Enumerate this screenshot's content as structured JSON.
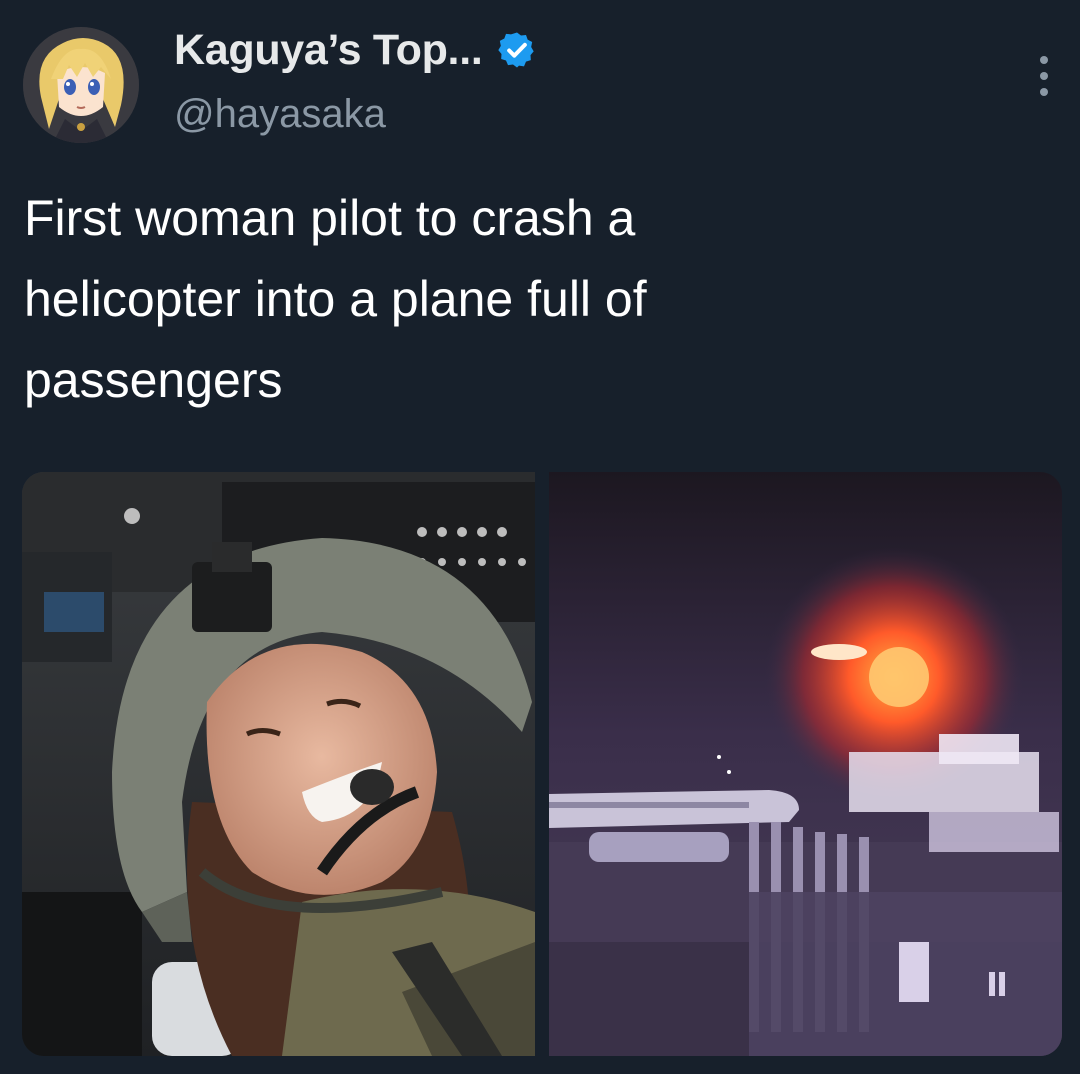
{
  "author": {
    "display_name": "Kaguya’s Top...",
    "handle": "@hayasaka",
    "verified": true,
    "avatar_icon": "anime-avatar-icon",
    "verified_color": "#1d9bf0"
  },
  "tweet": {
    "text": "First woman pilot to crash a\nhelicopter into a plane full of\npassengers"
  },
  "media": [
    {
      "kind": "photo",
      "description_icon": "pilot-photo"
    },
    {
      "kind": "photo",
      "description_icon": "night-crash-photo"
    }
  ],
  "colors": {
    "background": "#17202b",
    "text_primary": "#ffffff",
    "text_secondary": "#8b98a5",
    "accent": "#1d9bf0"
  }
}
